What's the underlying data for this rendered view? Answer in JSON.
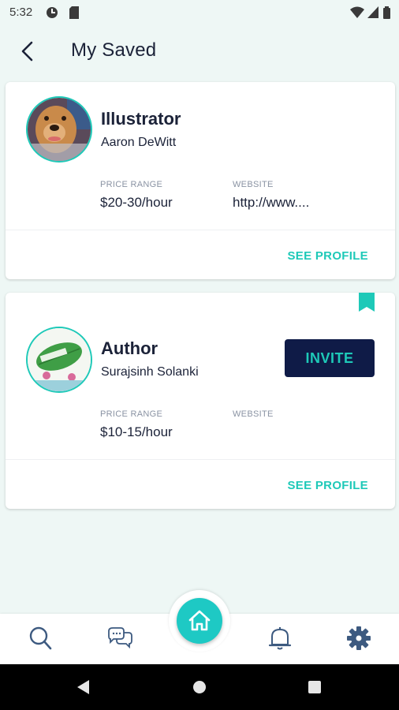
{
  "status_bar": {
    "time": "5:32"
  },
  "header": {
    "title": "My Saved"
  },
  "cards": [
    {
      "role": "Illustrator",
      "name": "Aaron DeWitt",
      "price_label": "PRICE RANGE",
      "price_value": "$20-30/hour",
      "website_label": "WEBSITE",
      "website_value": "http://www....",
      "see_profile": "SEE PROFILE"
    },
    {
      "role": "Author",
      "name": "Surajsinh Solanki",
      "price_label": "PRICE RANGE",
      "price_value": "$10-15/hour",
      "website_label": "WEBSITE",
      "website_value": "",
      "see_profile": "SEE PROFILE",
      "invite_label": "INVITE"
    }
  ],
  "bottom_nav": [
    "search-icon",
    "chat-icon",
    "home-icon",
    "bell-icon",
    "gear-icon"
  ],
  "colors": {
    "accent": "#1ec9b8",
    "navy": "#0f1b47",
    "background": "#eef7f5"
  }
}
